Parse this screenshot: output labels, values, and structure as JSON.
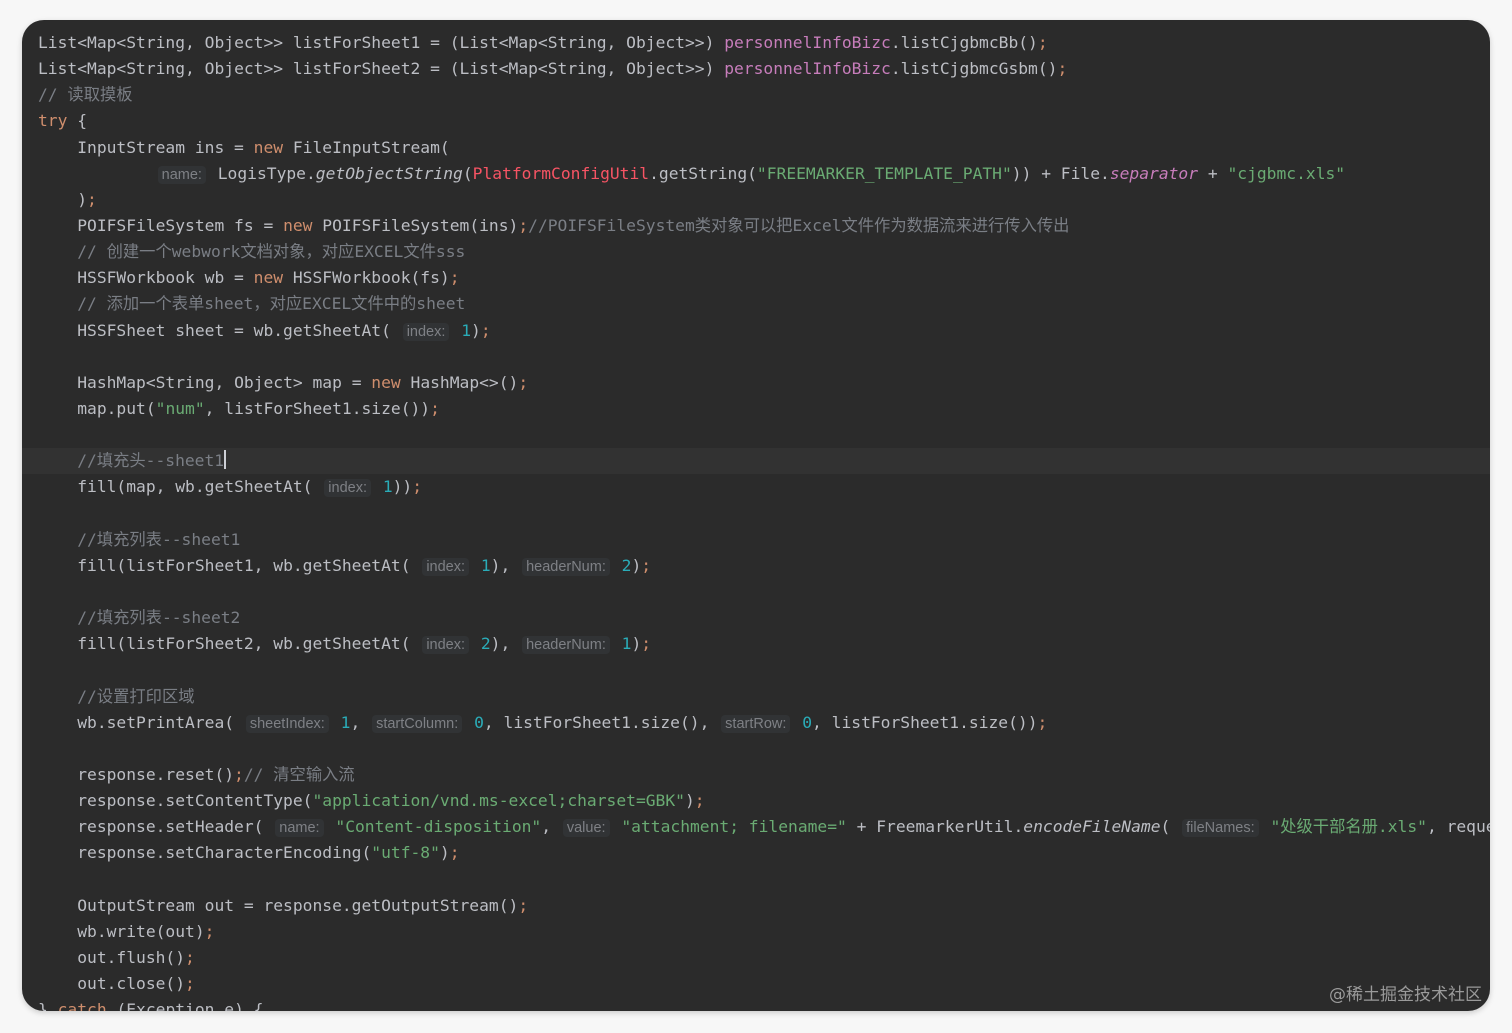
{
  "editor": {
    "theme_colors": {
      "background": "#2b2b2b",
      "keyword": "#cf8e6d",
      "string": "#6aab73",
      "comment": "#7a7e85",
      "field": "#c77dbb",
      "number": "#2aacb8",
      "plain": "#bcbec4"
    },
    "lines": [
      [
        [
          "plain",
          "List<Map<String"
        ],
        [
          "punc",
          ", "
        ],
        [
          "plain",
          "Object>> listForSheet1 = (List<Map<String"
        ],
        [
          "punc",
          ", "
        ],
        [
          "plain",
          "Object>>) "
        ],
        [
          "field",
          "personnelInfoBizc"
        ],
        [
          "plain",
          ".listCjgbmcBb()"
        ],
        [
          "semi",
          ";"
        ]
      ],
      [
        [
          "plain",
          "List<Map<String"
        ],
        [
          "punc",
          ", "
        ],
        [
          "plain",
          "Object>> listForSheet2 = (List<Map<String"
        ],
        [
          "punc",
          ", "
        ],
        [
          "plain",
          "Object>>) "
        ],
        [
          "field",
          "personnelInfoBizc"
        ],
        [
          "plain",
          ".listCjgbmcGsbm()"
        ],
        [
          "semi",
          ";"
        ]
      ],
      [
        [
          "comment",
          "// 读取摸板"
        ]
      ],
      [
        [
          "kw",
          "try "
        ],
        [
          "plain",
          "{"
        ]
      ],
      [
        [
          "plain",
          "    InputStream ins = "
        ],
        [
          "kw",
          "new "
        ],
        [
          "plain",
          "FileInputStream("
        ]
      ],
      [
        [
          "plain",
          "            "
        ],
        [
          "hint",
          "name:"
        ],
        [
          "plain",
          " LogisType."
        ],
        [
          "italic",
          "getObjectString"
        ],
        [
          "plain",
          "("
        ],
        [
          "red",
          "PlatformConfigUtil"
        ],
        [
          "plain",
          ".getString("
        ],
        [
          "str",
          "\"FREEMARKER_TEMPLATE_PATH\""
        ],
        [
          "plain",
          ")) + File."
        ],
        [
          "static",
          "separator"
        ],
        [
          "plain",
          " + "
        ],
        [
          "str",
          "\"cjgbmc.xls\""
        ]
      ],
      [
        [
          "plain",
          "    )"
        ],
        [
          "semi",
          ";"
        ]
      ],
      [
        [
          "plain",
          "    POIFSFileSystem fs = "
        ],
        [
          "kw",
          "new "
        ],
        [
          "plain",
          "POIFSFileSystem(ins)"
        ],
        [
          "semi",
          ";"
        ],
        [
          "comment",
          "//POIFSFileSystem类对象可以把Excel文件作为数据流来进行传入传出"
        ]
      ],
      [
        [
          "comment",
          "    // 创建一个webwork文档对象，对应EXCEL文件sss"
        ]
      ],
      [
        [
          "plain",
          "    HSSFWorkbook wb = "
        ],
        [
          "kw",
          "new "
        ],
        [
          "plain",
          "HSSFWorkbook(fs)"
        ],
        [
          "semi",
          ";"
        ]
      ],
      [
        [
          "comment",
          "    // 添加一个表单sheet，对应EXCEL文件中的sheet"
        ]
      ],
      [
        [
          "plain",
          "    HSSFSheet sheet = wb.getSheetAt( "
        ],
        [
          "hint",
          "index:"
        ],
        [
          "plain",
          " "
        ],
        [
          "num",
          "1"
        ],
        [
          "plain",
          ")"
        ],
        [
          "semi",
          ";"
        ]
      ],
      [],
      [
        [
          "plain",
          "    HashMap<String"
        ],
        [
          "punc",
          ", "
        ],
        [
          "plain",
          "Object> map = "
        ],
        [
          "kw",
          "new "
        ],
        [
          "plain",
          "HashMap<>()"
        ],
        [
          "semi",
          ";"
        ]
      ],
      [
        [
          "plain",
          "    map.put("
        ],
        [
          "str",
          "\"num\""
        ],
        [
          "punc",
          ", "
        ],
        [
          "plain",
          "listForSheet1.size())"
        ],
        [
          "semi",
          ";"
        ]
      ],
      [],
      [
        [
          "comment",
          "    //填充头--sheet1"
        ],
        [
          "caret",
          ""
        ]
      ],
      [
        [
          "plain",
          "    fill(map"
        ],
        [
          "punc",
          ", "
        ],
        [
          "plain",
          "wb.getSheetAt( "
        ],
        [
          "hint",
          "index:"
        ],
        [
          "plain",
          " "
        ],
        [
          "num",
          "1"
        ],
        [
          "plain",
          "))"
        ],
        [
          "semi",
          ";"
        ]
      ],
      [],
      [
        [
          "comment",
          "    //填充列表--sheet1"
        ]
      ],
      [
        [
          "plain",
          "    fill(listForSheet1"
        ],
        [
          "punc",
          ", "
        ],
        [
          "plain",
          "wb.getSheetAt( "
        ],
        [
          "hint",
          "index:"
        ],
        [
          "plain",
          " "
        ],
        [
          "num",
          "1"
        ],
        [
          "plain",
          ")"
        ],
        [
          "punc",
          ", "
        ],
        [
          "hint",
          "headerNum:"
        ],
        [
          "plain",
          " "
        ],
        [
          "num",
          "2"
        ],
        [
          "plain",
          ")"
        ],
        [
          "semi",
          ";"
        ]
      ],
      [],
      [
        [
          "comment",
          "    //填充列表--sheet2"
        ]
      ],
      [
        [
          "plain",
          "    fill(listForSheet2"
        ],
        [
          "punc",
          ", "
        ],
        [
          "plain",
          "wb.getSheetAt( "
        ],
        [
          "hint",
          "index:"
        ],
        [
          "plain",
          " "
        ],
        [
          "num",
          "2"
        ],
        [
          "plain",
          ")"
        ],
        [
          "punc",
          ", "
        ],
        [
          "hint",
          "headerNum:"
        ],
        [
          "plain",
          " "
        ],
        [
          "num",
          "1"
        ],
        [
          "plain",
          ")"
        ],
        [
          "semi",
          ";"
        ]
      ],
      [],
      [
        [
          "comment",
          "    //设置打印区域"
        ]
      ],
      [
        [
          "plain",
          "    wb.setPrintArea( "
        ],
        [
          "hint",
          "sheetIndex:"
        ],
        [
          "plain",
          " "
        ],
        [
          "num",
          "1"
        ],
        [
          "punc",
          ", "
        ],
        [
          "hint",
          "startColumn:"
        ],
        [
          "plain",
          " "
        ],
        [
          "num",
          "0"
        ],
        [
          "punc",
          ", "
        ],
        [
          "plain",
          "listForSheet1.size()"
        ],
        [
          "punc",
          ", "
        ],
        [
          "hint",
          "startRow:"
        ],
        [
          "plain",
          " "
        ],
        [
          "num",
          "0"
        ],
        [
          "punc",
          ", "
        ],
        [
          "plain",
          "listForSheet1.size())"
        ],
        [
          "semi",
          ";"
        ]
      ],
      [],
      [
        [
          "plain",
          "    response.reset()"
        ],
        [
          "semi",
          ";"
        ],
        [
          "comment",
          "// 清空输入流"
        ]
      ],
      [
        [
          "plain",
          "    response.setContentType("
        ],
        [
          "str",
          "\"application/vnd.ms-excel;charset=GBK\""
        ],
        [
          "plain",
          ")"
        ],
        [
          "semi",
          ";"
        ]
      ],
      [
        [
          "plain",
          "    response.setHeader( "
        ],
        [
          "hint",
          "name:"
        ],
        [
          "plain",
          " "
        ],
        [
          "str",
          "\"Content-disposition\""
        ],
        [
          "punc",
          ", "
        ],
        [
          "hint",
          "value:"
        ],
        [
          "plain",
          " "
        ],
        [
          "str",
          "\"attachment; filename=\""
        ],
        [
          "plain",
          " + FreemarkerUtil."
        ],
        [
          "italic",
          "encodeFileName"
        ],
        [
          "plain",
          "( "
        ],
        [
          "hint",
          "fileNames:"
        ],
        [
          "plain",
          " "
        ],
        [
          "str",
          "\"处级干部名册.xls\""
        ],
        [
          "punc",
          ", "
        ],
        [
          "plain",
          "request))"
        ],
        [
          "semi",
          ";"
        ]
      ],
      [
        [
          "plain",
          "    response.setCharacterEncoding("
        ],
        [
          "str",
          "\"utf-8\""
        ],
        [
          "plain",
          ")"
        ],
        [
          "semi",
          ";"
        ]
      ],
      [],
      [
        [
          "plain",
          "    OutputStream out = response.getOutputStream()"
        ],
        [
          "semi",
          ";"
        ]
      ],
      [
        [
          "plain",
          "    wb.write(out)"
        ],
        [
          "semi",
          ";"
        ]
      ],
      [
        [
          "plain",
          "    out.flush()"
        ],
        [
          "semi",
          ";"
        ]
      ],
      [
        [
          "plain",
          "    out.close()"
        ],
        [
          "semi",
          ";"
        ]
      ],
      [
        [
          "plain",
          "} "
        ],
        [
          "kw",
          "catch "
        ],
        [
          "plain",
          "(Exception e) {"
        ]
      ]
    ],
    "current_line_index": 16
  },
  "watermark": {
    "text": "@稀土掘金技术社区"
  }
}
